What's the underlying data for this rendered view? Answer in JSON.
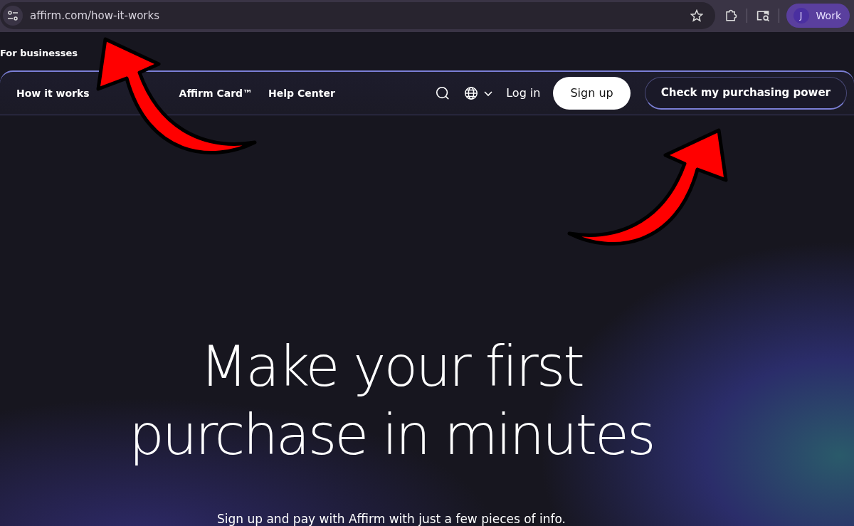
{
  "browser": {
    "url": "affirm.com/how-it-works",
    "profile": {
      "initial": "J",
      "label": "Work"
    }
  },
  "top_link": "For businesses",
  "nav": {
    "links": [
      {
        "label": "How it works"
      },
      {
        "label": "Affirm Card™"
      },
      {
        "label": "Help Center"
      }
    ],
    "login": "Log in",
    "signup": "Sign up",
    "cta": "Check my purchasing power"
  },
  "hero": {
    "title_lines": [
      "Make your first",
      "purchase in minutes"
    ],
    "subtitle": "Sign up and pay with Affirm with just a few pieces of info."
  }
}
